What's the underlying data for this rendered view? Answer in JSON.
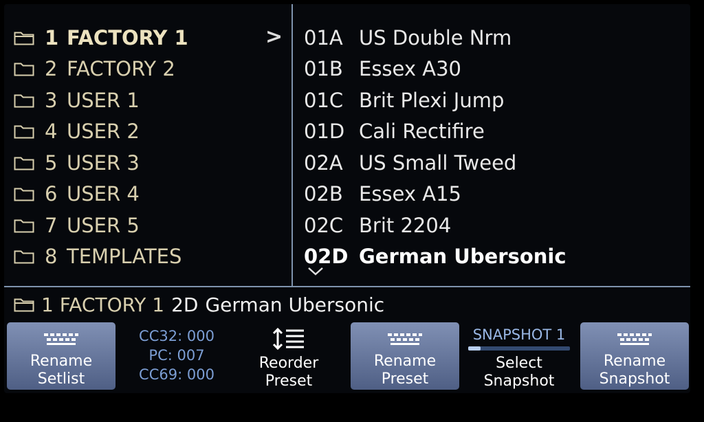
{
  "setlists": [
    {
      "num": "1",
      "name": "FACTORY 1",
      "selected": true
    },
    {
      "num": "2",
      "name": "FACTORY 2",
      "selected": false
    },
    {
      "num": "3",
      "name": "USER 1",
      "selected": false
    },
    {
      "num": "4",
      "name": "USER 2",
      "selected": false
    },
    {
      "num": "5",
      "name": "USER 3",
      "selected": false
    },
    {
      "num": "6",
      "name": "USER 4",
      "selected": false
    },
    {
      "num": "7",
      "name": "USER 5",
      "selected": false
    },
    {
      "num": "8",
      "name": "TEMPLATES",
      "selected": false
    }
  ],
  "presets": [
    {
      "id": "01A",
      "name": "US Double Nrm",
      "selected": false
    },
    {
      "id": "01B",
      "name": "Essex A30",
      "selected": false
    },
    {
      "id": "01C",
      "name": "Brit Plexi Jump",
      "selected": false
    },
    {
      "id": "01D",
      "name": "Cali Rectifire",
      "selected": false
    },
    {
      "id": "02A",
      "name": "US Small Tweed",
      "selected": false
    },
    {
      "id": "02B",
      "name": "Essex A15",
      "selected": false
    },
    {
      "id": "02C",
      "name": "Brit 2204",
      "selected": false
    },
    {
      "id": "02D",
      "name": "German Ubersonic",
      "selected": true
    }
  ],
  "status": {
    "setlist": "1 FACTORY 1",
    "preset_id": "2D",
    "preset_name": "German Ubersonic"
  },
  "buttons": {
    "rename_setlist": [
      "Rename",
      "Setlist"
    ],
    "reorder_preset": [
      "Reorder",
      "Preset"
    ],
    "rename_preset": [
      "Rename",
      "Preset"
    ],
    "select_snapshot": [
      "Select",
      "Snapshot"
    ],
    "rename_snapshot": [
      "Rename",
      "Snapshot"
    ]
  },
  "midi": {
    "cc32": "CC32: 000",
    "pc": "PC: 007",
    "cc69": "CC69: 000"
  },
  "snapshot": {
    "title": "SNAPSHOT 1"
  },
  "icons": {
    "folder": "folder-icon",
    "keyboard": "keyboard-icon",
    "reorder": "reorder-icon",
    "chevron_right": "chevron-right-icon",
    "chevron_down": "chevron-down-icon"
  },
  "colors": {
    "accent_cream": "#d8cfae",
    "button_blue": "#6a7aa0",
    "midi_blue": "#7c9ed4",
    "divider": "#7f93ad"
  }
}
